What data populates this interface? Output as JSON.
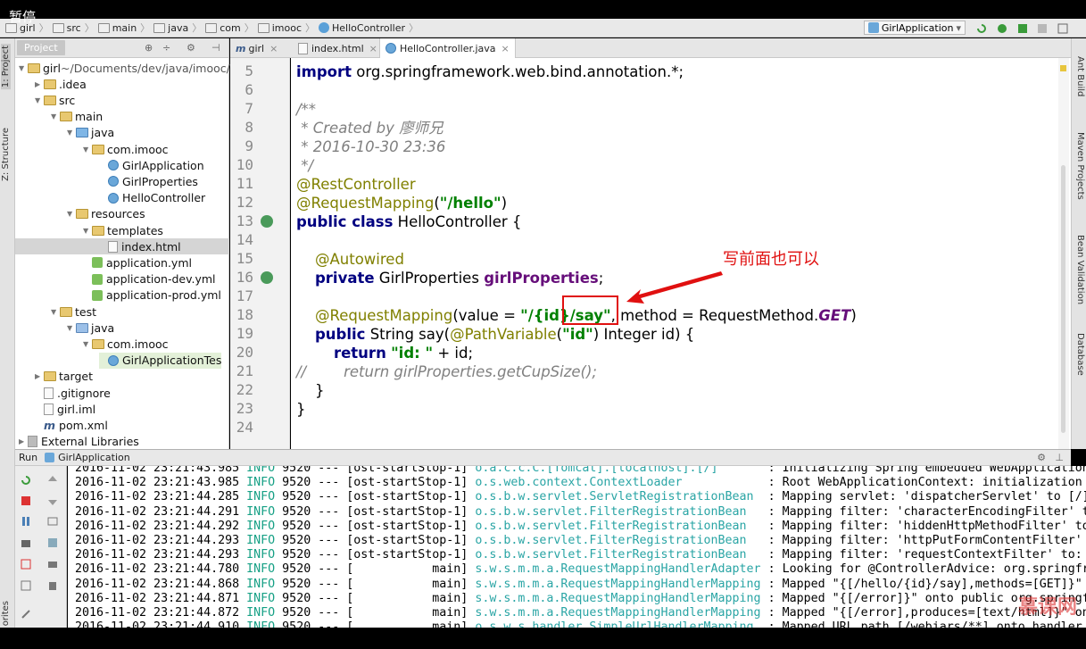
{
  "overlay": {
    "pause_label": "暂停"
  },
  "breadcrumb": [
    "girl",
    "src",
    "main",
    "java",
    "com",
    "imooc",
    "HelloController"
  ],
  "run_config": {
    "name": "GirlApplication"
  },
  "side_tabs": {
    "left": [
      "1: Project",
      "Z: Structure"
    ],
    "right": [
      "Ant Build",
      "Maven Projects",
      "Bean Validation",
      "Database"
    ],
    "bottom_left": "orites"
  },
  "project": {
    "tab_label": "Project",
    "tree": [
      {
        "label": "girl",
        "suffix": "~/Documents/dev/java/imooc/",
        "indent": 0,
        "arrow": "▼",
        "icon": "fold"
      },
      {
        "label": ".idea",
        "indent": 1,
        "arrow": "▶",
        "icon": "fold"
      },
      {
        "label": "src",
        "indent": 1,
        "arrow": "▼",
        "icon": "fold"
      },
      {
        "label": "main",
        "indent": 2,
        "arrow": "▼",
        "icon": "fold"
      },
      {
        "label": "java",
        "indent": 3,
        "arrow": "▼",
        "icon": "fold src"
      },
      {
        "label": "com.imooc",
        "indent": 4,
        "arrow": "▼",
        "icon": "fold"
      },
      {
        "label": "GirlApplication",
        "indent": 5,
        "arrow": "",
        "icon": "ccls"
      },
      {
        "label": "GirlProperties",
        "indent": 5,
        "arrow": "",
        "icon": "ccls"
      },
      {
        "label": "HelloController",
        "indent": 5,
        "arrow": "",
        "icon": "ccls"
      },
      {
        "label": "resources",
        "indent": 3,
        "arrow": "▼",
        "icon": "fold"
      },
      {
        "label": "templates",
        "indent": 4,
        "arrow": "▼",
        "icon": "fold"
      },
      {
        "label": "index.html",
        "indent": 5,
        "arrow": "",
        "icon": "fil",
        "selected": true
      },
      {
        "label": "application.yml",
        "indent": 4,
        "arrow": "",
        "icon": "leaf"
      },
      {
        "label": "application-dev.yml",
        "indent": 4,
        "arrow": "",
        "icon": "leaf"
      },
      {
        "label": "application-prod.yml",
        "indent": 4,
        "arrow": "",
        "icon": "leaf"
      },
      {
        "label": "test",
        "indent": 2,
        "arrow": "▼",
        "icon": "fold"
      },
      {
        "label": "java",
        "indent": 3,
        "arrow": "▼",
        "icon": "fold blue"
      },
      {
        "label": "com.imooc",
        "indent": 4,
        "arrow": "▼",
        "icon": "fold"
      },
      {
        "label": "GirlApplicationTes",
        "indent": 5,
        "arrow": "",
        "icon": "ccls",
        "highlight": true
      },
      {
        "label": "target",
        "indent": 1,
        "arrow": "▶",
        "icon": "fold"
      },
      {
        "label": ".gitignore",
        "indent": 1,
        "arrow": "",
        "icon": "fil"
      },
      {
        "label": "girl.iml",
        "indent": 1,
        "arrow": "",
        "icon": "fil"
      },
      {
        "label": "pom.xml",
        "indent": 1,
        "arrow": "",
        "icon": "m"
      },
      {
        "label": "External Libraries",
        "indent": 0,
        "arrow": "▶",
        "icon": "lib"
      }
    ]
  },
  "editor": {
    "tabs": [
      {
        "label": "girl",
        "prefix": "m"
      },
      {
        "label": "index.html",
        "prefix": ""
      },
      {
        "label": "HelloController.java",
        "prefix": "",
        "active": true
      }
    ],
    "line_numbers": [
      "5",
      "6",
      "7",
      "8",
      "9",
      "10",
      "11",
      "12",
      "13",
      "14",
      "15",
      "16",
      "17",
      "18",
      "19",
      "20",
      "21",
      "22",
      "23",
      "24"
    ],
    "annotation_text": "写前面也可以"
  },
  "run": {
    "title": "Run",
    "app": "GirlApplication",
    "logs": [
      {
        "ts": "2016-11-02 23:21:43.985",
        "lvl": "INFO",
        "pid": "9520",
        "th": "[ost-startStop-1]",
        "lg": "o.a.c.c.C.[Tomcat].[localhost].[/]",
        "msg": ": Initializing Spring embedded WebApplicationCon"
      },
      {
        "ts": "2016-11-02 23:21:43.985",
        "lvl": "INFO",
        "pid": "9520",
        "th": "[ost-startStop-1]",
        "lg": "o.s.web.context.ContextLoader",
        "msg": ": Root WebApplicationContext: initialization com"
      },
      {
        "ts": "2016-11-02 23:21:44.285",
        "lvl": "INFO",
        "pid": "9520",
        "th": "[ost-startStop-1]",
        "lg": "o.s.b.w.servlet.ServletRegistrationBean",
        "msg": ": Mapping servlet: 'dispatcherServlet' to [/]"
      },
      {
        "ts": "2016-11-02 23:21:44.291",
        "lvl": "INFO",
        "pid": "9520",
        "th": "[ost-startStop-1]",
        "lg": "o.s.b.w.servlet.FilterRegistrationBean",
        "msg": ": Mapping filter: 'characterEncodingFilter' to:"
      },
      {
        "ts": "2016-11-02 23:21:44.292",
        "lvl": "INFO",
        "pid": "9520",
        "th": "[ost-startStop-1]",
        "lg": "o.s.b.w.servlet.FilterRegistrationBean",
        "msg": ": Mapping filter: 'hiddenHttpMethodFilter' to: ["
      },
      {
        "ts": "2016-11-02 23:21:44.293",
        "lvl": "INFO",
        "pid": "9520",
        "th": "[ost-startStop-1]",
        "lg": "o.s.b.w.servlet.FilterRegistrationBean",
        "msg": ": Mapping filter: 'httpPutFormContentFilter' to:"
      },
      {
        "ts": "2016-11-02 23:21:44.293",
        "lvl": "INFO",
        "pid": "9520",
        "th": "[ost-startStop-1]",
        "lg": "o.s.b.w.servlet.FilterRegistrationBean",
        "msg": ": Mapping filter: 'requestContextFilter' to: [/*"
      },
      {
        "ts": "2016-11-02 23:21:44.780",
        "lvl": "INFO",
        "pid": "9520",
        "th": "[           main]",
        "lg": "s.w.s.m.m.a.RequestMappingHandlerAdapter",
        "msg": ": Looking for @ControllerAdvice: org.springframe"
      },
      {
        "ts": "2016-11-02 23:21:44.868",
        "lvl": "INFO",
        "pid": "9520",
        "th": "[           main]",
        "lg": "s.w.s.m.m.a.RequestMappingHandlerMapping",
        "msg": ": Mapped \"{[/hello/{id}/say],methods=[GET]}\" ont"
      },
      {
        "ts": "2016-11-02 23:21:44.871",
        "lvl": "INFO",
        "pid": "9520",
        "th": "[           main]",
        "lg": "s.w.s.m.m.a.RequestMappingHandlerMapping",
        "msg": ": Mapped \"{[/error]}\" onto public org.springfram"
      },
      {
        "ts": "2016-11-02 23:21:44.872",
        "lvl": "INFO",
        "pid": "9520",
        "th": "[           main]",
        "lg": "s.w.s.m.m.a.RequestMappingHandlerMapping",
        "msg": ": Mapped \"{[/error],produces=[text/html]}\" onto"
      },
      {
        "ts": "2016-11-02 23:21:44.910",
        "lvl": "INFO",
        "pid": "9520",
        "th": "[           main]",
        "lg": "o.s.w.s.handler.SimpleUrlHandlerMapping",
        "msg": ": Mapped URL path [/webjars/**] onto handler of"
      }
    ]
  },
  "watermark": "慕课网"
}
